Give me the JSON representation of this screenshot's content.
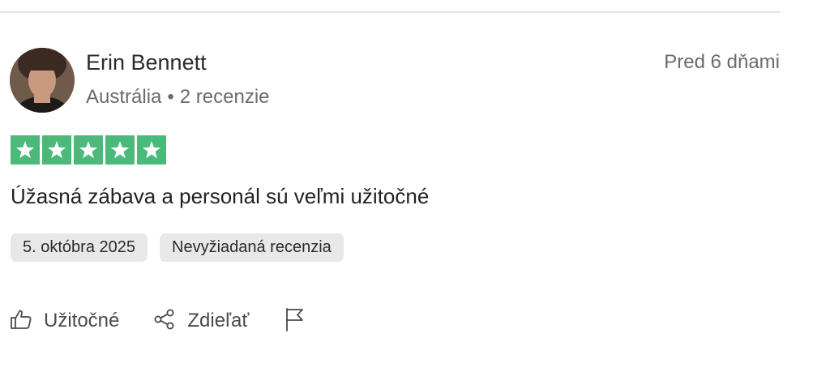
{
  "review": {
    "author": {
      "name": "Erin Bennett",
      "country": "Austrália",
      "separator": "•",
      "review_count": "2 recenzie"
    },
    "relative_date": "Pred 6 dňami",
    "rating": {
      "stars": 5,
      "max": 5,
      "color": "#4bb97a"
    },
    "title": "Úžasná zábava a personál sú veľmi užitočné",
    "tags": {
      "date": "5. októbra 2025",
      "type": "Nevyžiadaná recenzia"
    },
    "actions": {
      "helpful_label": "Užitočné",
      "share_label": "Zdieľať",
      "helpful_icon": "thumbs-up-icon",
      "share_icon": "share-icon",
      "report_icon": "flag-icon"
    }
  }
}
